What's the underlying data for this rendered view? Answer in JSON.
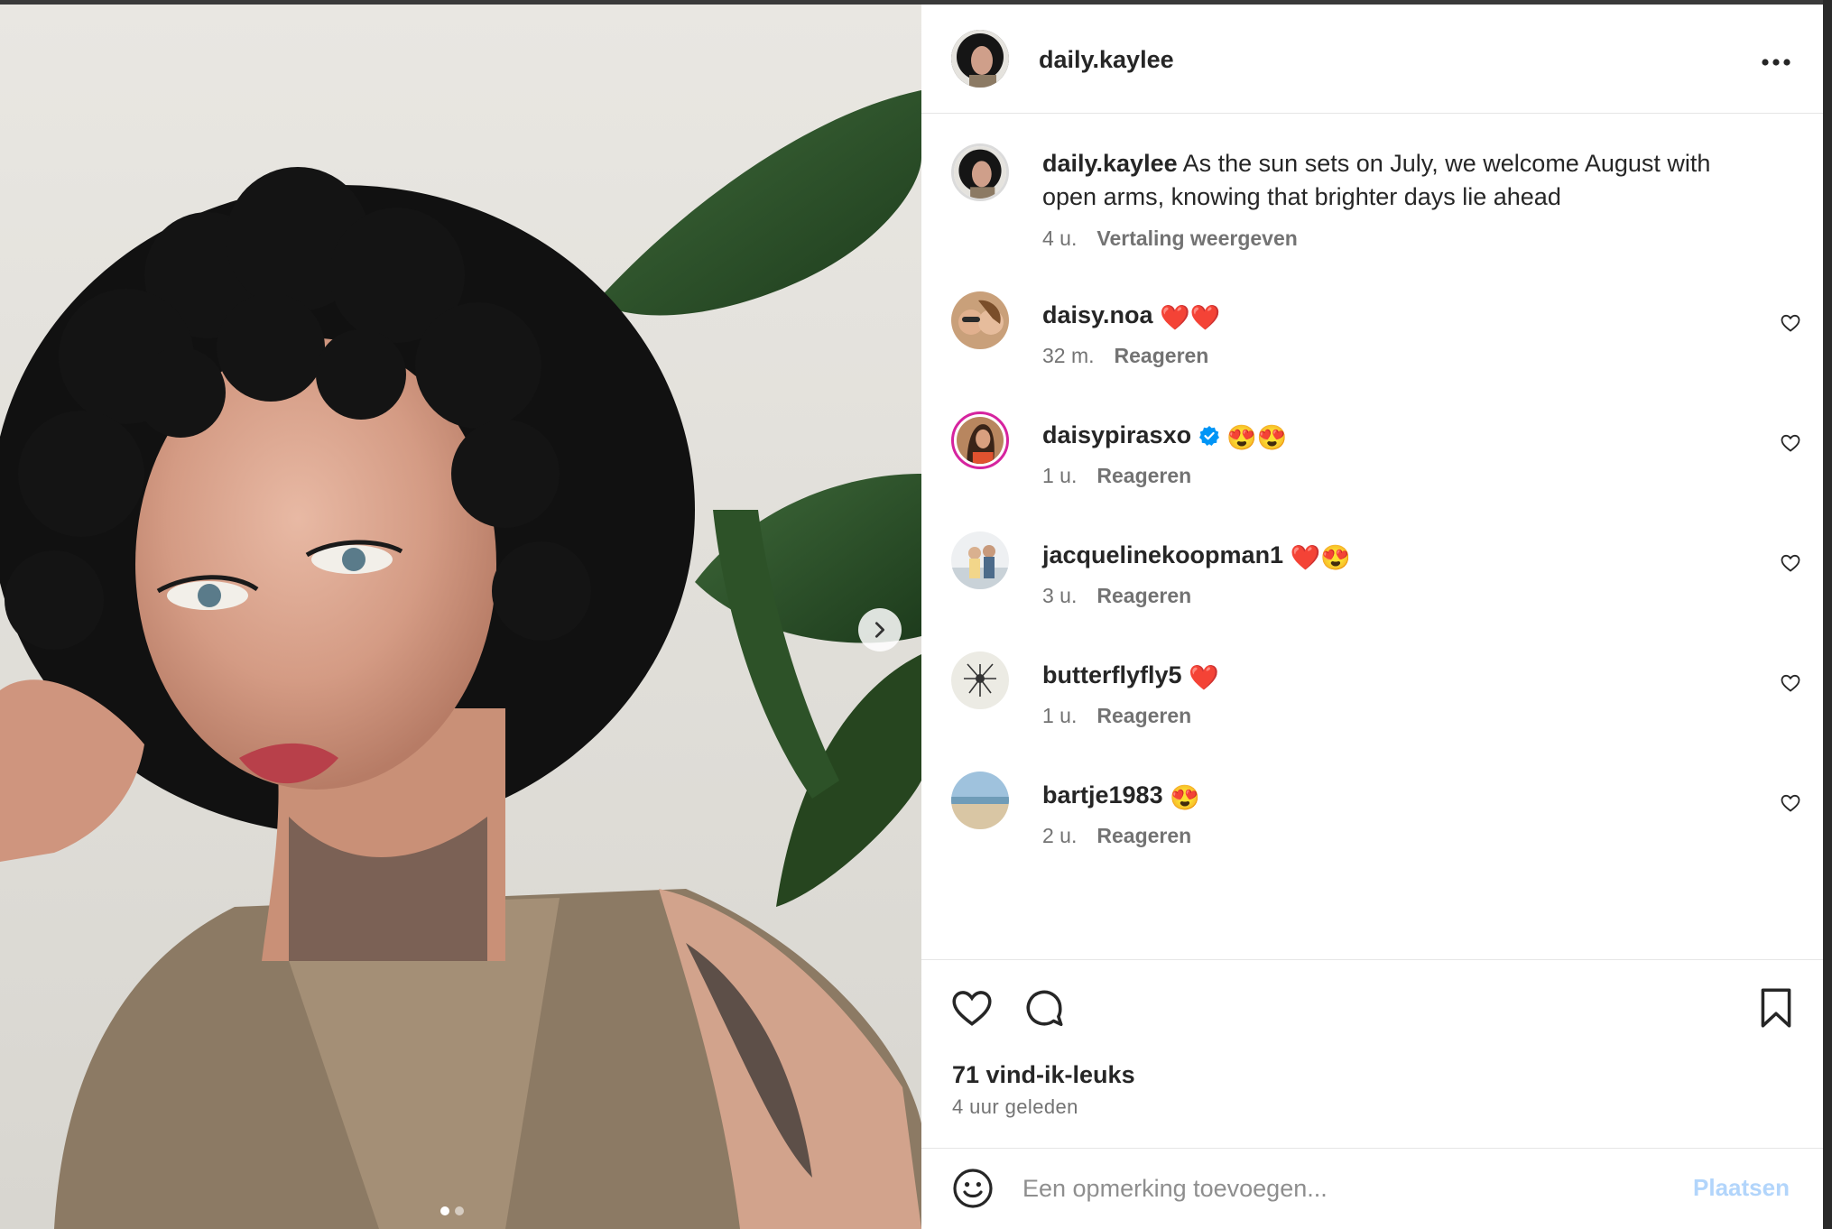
{
  "post": {
    "author": "daily.kaylee",
    "caption": "As the sun sets on July, we welcome August with open arms, knowing that brighter days lie ahead",
    "caption_time": "4 u.",
    "translate_label": "Vertaling weergeven",
    "more_icon": "more-horizontal-icon"
  },
  "photo": {
    "next_icon": "chevron-right-icon",
    "slide_count": 2,
    "active_slide": 1
  },
  "comments": [
    {
      "user": "daisy.noa",
      "emoji": "❤️❤️",
      "time": "32 m.",
      "reply": "Reageren",
      "verified": false
    },
    {
      "user": "daisypirasxo",
      "emoji": "😍😍",
      "time": "1 u.",
      "reply": "Reageren",
      "verified": true
    },
    {
      "user": "jacquelinekoopman1",
      "emoji": "❤️😍",
      "time": "3 u.",
      "reply": "Reageren",
      "verified": false
    },
    {
      "user": "butterflyfly5",
      "emoji": "❤️",
      "time": "1 u.",
      "reply": "Reageren",
      "verified": false
    },
    {
      "user": "bartje1983",
      "emoji": "😍",
      "time": "2 u.",
      "reply": "Reageren",
      "verified": false
    }
  ],
  "actions": {
    "likes": "71 vind-ik-leuks",
    "time": "4 uur geleden",
    "like_icon": "heart-icon",
    "comment_icon": "comment-icon",
    "save_icon": "bookmark-icon"
  },
  "composer": {
    "placeholder": "Een opmerking toevoegen...",
    "post_label": "Plaatsen",
    "post_color": "#b2d5fb",
    "emoji_icon": "smiley-icon"
  },
  "colors": {
    "text": "#262626",
    "muted": "#737373",
    "verified": "#0095f6"
  }
}
